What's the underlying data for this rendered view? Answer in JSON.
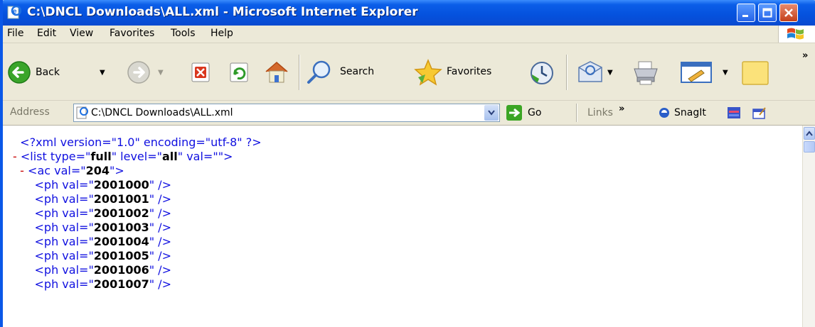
{
  "window": {
    "title": "C:\\DNCL Downloads\\ALL.xml - Microsoft Internet Explorer"
  },
  "menu": [
    "File",
    "Edit",
    "View",
    "Favorites",
    "Tools",
    "Help"
  ],
  "toolbar": {
    "back_label": "Back",
    "search_label": "Search",
    "favorites_label": "Favorites"
  },
  "address": {
    "label": "Address",
    "value": "C:\\DNCL Downloads\\ALL.xml",
    "go_label": "Go",
    "links_label": "Links",
    "snagit_label": "SnagIt"
  },
  "content": {
    "pi_line": "<?xml version=\"1.0\" encoding=\"utf-8\" ?>",
    "collapse_symbol": "-",
    "list": {
      "open": "<list ",
      "attr_type": "type=",
      "type_val": "full",
      "attr_level": " level=",
      "level_val": "all",
      "attr_val": " val=",
      "val_val": "",
      "close": ">"
    },
    "ac": {
      "open": "<ac val=",
      "val": "204",
      "close": ">"
    },
    "ph_open": "<ph val=",
    "ph_close": " />",
    "ph_values": [
      "2001000",
      "2001001",
      "2001002",
      "2001003",
      "2001004",
      "2001005",
      "2001006",
      "2001007"
    ]
  }
}
